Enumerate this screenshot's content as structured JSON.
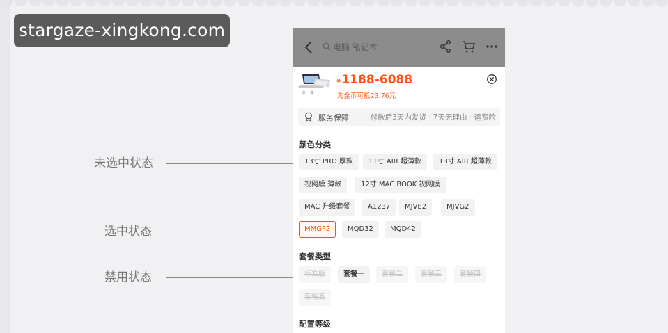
{
  "watermark": "stargaze-xingkong.com",
  "annotations": [
    {
      "label": "未选中状态"
    },
    {
      "label": "选中状态"
    },
    {
      "label": "禁用状态"
    }
  ],
  "header": {
    "search_placeholder": "电脑 笔记本",
    "icons": [
      "back-icon",
      "search-icon",
      "share-icon",
      "cart-icon",
      "more-icon"
    ],
    "bar_color": "#8c8c8c"
  },
  "product": {
    "currency": "¥",
    "price": "1188-6088",
    "coin_text": "淘金币可抵23.76元",
    "price_color": "#ff4f0d"
  },
  "service": {
    "label": "服务保障",
    "desc": "付款后3天内发货 · 7天无理由 · 运费险"
  },
  "sections": {
    "color": {
      "title": "颜色分类",
      "options": [
        {
          "label": "13寸 PRO 厚款",
          "state": "normal"
        },
        {
          "label": "11寸  AIR 超薄款",
          "state": "normal"
        },
        {
          "label": "13寸  AIR 超薄款",
          "state": "normal"
        },
        {
          "label": "视网膜  薄款",
          "state": "normal"
        },
        {
          "label": "12寸 MAC BOOK 视网膜",
          "state": "normal"
        },
        {
          "label": "MAC 升级套餐",
          "state": "normal"
        },
        {
          "label": "A1237",
          "state": "normal"
        },
        {
          "label": "MJVE2",
          "state": "normal"
        },
        {
          "label": "MJVG2",
          "state": "normal"
        },
        {
          "label": "MMGF2",
          "state": "selected"
        },
        {
          "label": "MQD32",
          "state": "normal"
        },
        {
          "label": "MQD42",
          "state": "normal"
        }
      ]
    },
    "package": {
      "title": "套餐类型",
      "options": [
        {
          "label": "标准版",
          "state": "disabled"
        },
        {
          "label": "套餐一",
          "state": "normal"
        },
        {
          "label": "套餐二",
          "state": "disabled"
        },
        {
          "label": "套餐三",
          "state": "disabled"
        },
        {
          "label": "套餐四",
          "state": "disabled"
        },
        {
          "label": "套餐五",
          "state": "disabled"
        }
      ]
    },
    "config": {
      "title": "配置等级"
    }
  },
  "colors": {
    "accent": "#ff5000",
    "chip_bg": "#f2f2f2",
    "disabled_text": "#c4c4c4"
  }
}
